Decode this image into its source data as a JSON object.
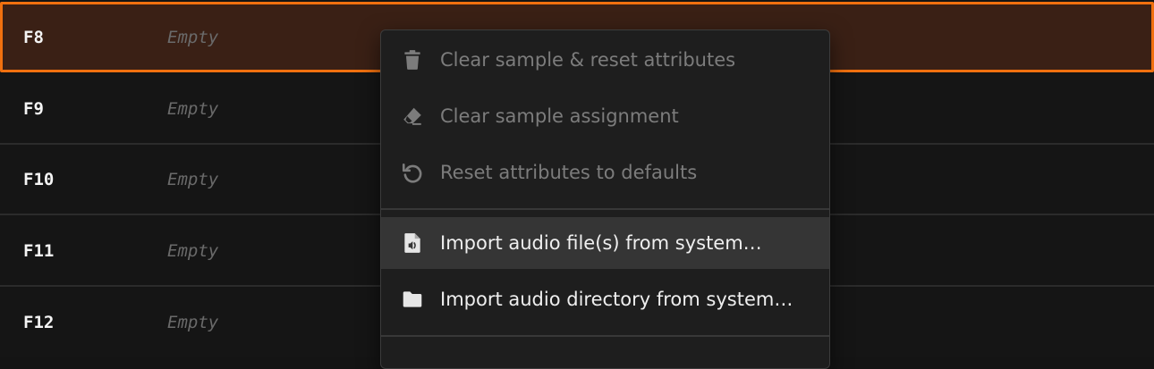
{
  "slots": [
    {
      "note": "F8",
      "sample": "Empty",
      "selected": true
    },
    {
      "note": "F9",
      "sample": "Empty",
      "selected": false
    },
    {
      "note": "F10",
      "sample": "Empty",
      "selected": false
    },
    {
      "note": "F11",
      "sample": "Empty",
      "selected": false
    },
    {
      "note": "F12",
      "sample": "Empty",
      "selected": false
    }
  ],
  "context_menu": {
    "items": [
      {
        "label": "Clear sample & reset attributes",
        "icon": "trash-icon",
        "enabled": false
      },
      {
        "label": "Clear sample assignment",
        "icon": "eraser-icon",
        "enabled": false
      },
      {
        "label": "Reset attributes to defaults",
        "icon": "undo-icon",
        "enabled": false
      },
      {
        "label": "Import audio file(s) from system…",
        "icon": "audio-file-icon",
        "enabled": true,
        "hovered": true
      },
      {
        "label": "Import audio directory from system…",
        "icon": "folder-icon",
        "enabled": true
      }
    ]
  },
  "colors": {
    "selection_border": "#f0700f",
    "selection_background": "#3a2015",
    "background": "#141414",
    "menu_background": "#1e1e1e",
    "menu_hover": "#353535"
  }
}
